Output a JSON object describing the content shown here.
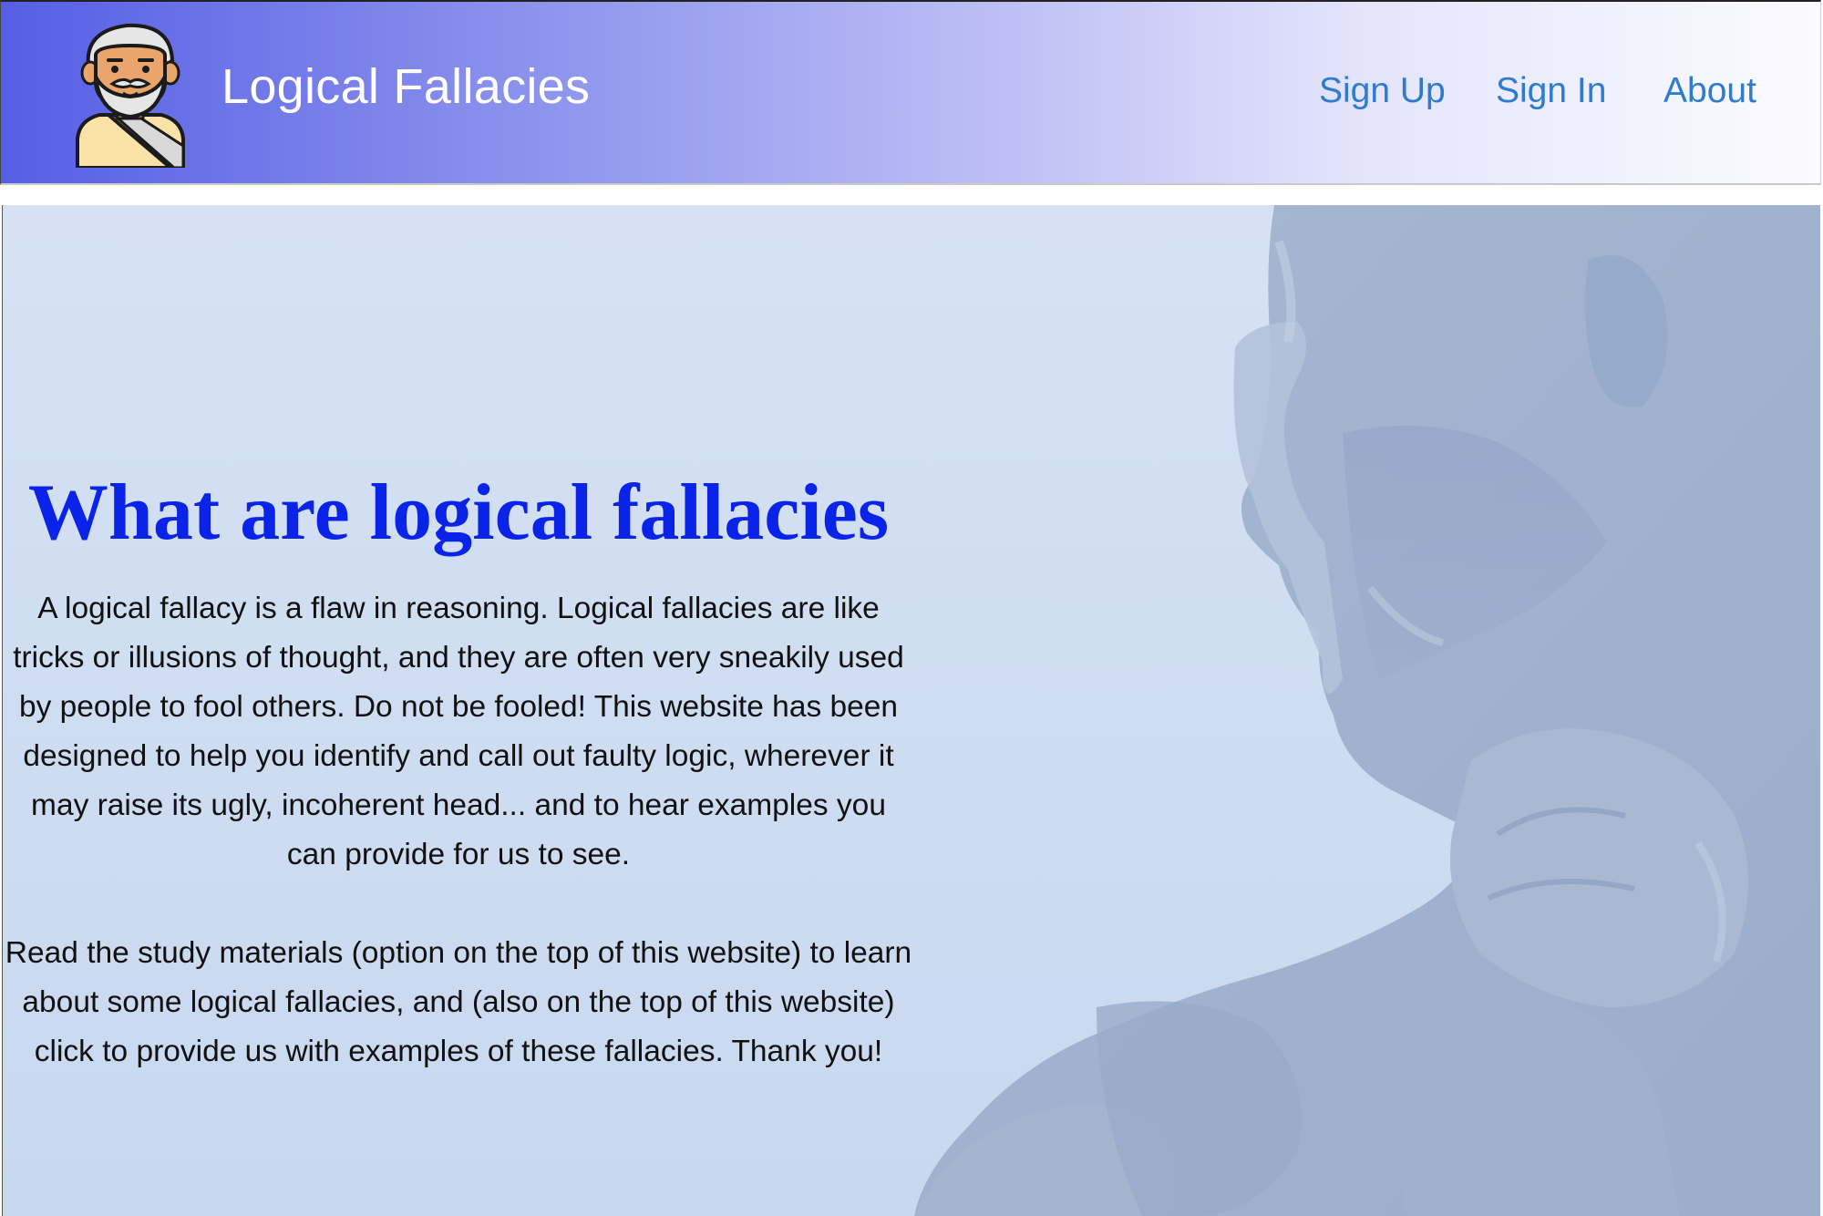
{
  "header": {
    "logo_icon": "philosopher-avatar-icon",
    "title": "Logical Fallacies",
    "nav": [
      {
        "label": "Sign Up"
      },
      {
        "label": "Sign In"
      },
      {
        "label": "About"
      }
    ],
    "link_color": "#2f7bcf"
  },
  "main": {
    "background_image": "thinker-statue-image",
    "heading": "What are logical fallacies",
    "heading_color": "#0a23e8",
    "paragraphs": [
      "A logical fallacy is a flaw in reasoning. Logical fallacies are like tricks or illusions of thought, and they are often very sneakily used by people to fool others. Do not be fooled! This website has been designed to help you identify and call out faulty logic, wherever it may raise its ugly, incoherent head... and to hear examples you can provide for us to see.",
      "Read the study materials (option on the top of this website) to learn about some logical fallacies, and (also on the top of this website) click to provide us with examples of these fallacies. Thank you!"
    ]
  }
}
